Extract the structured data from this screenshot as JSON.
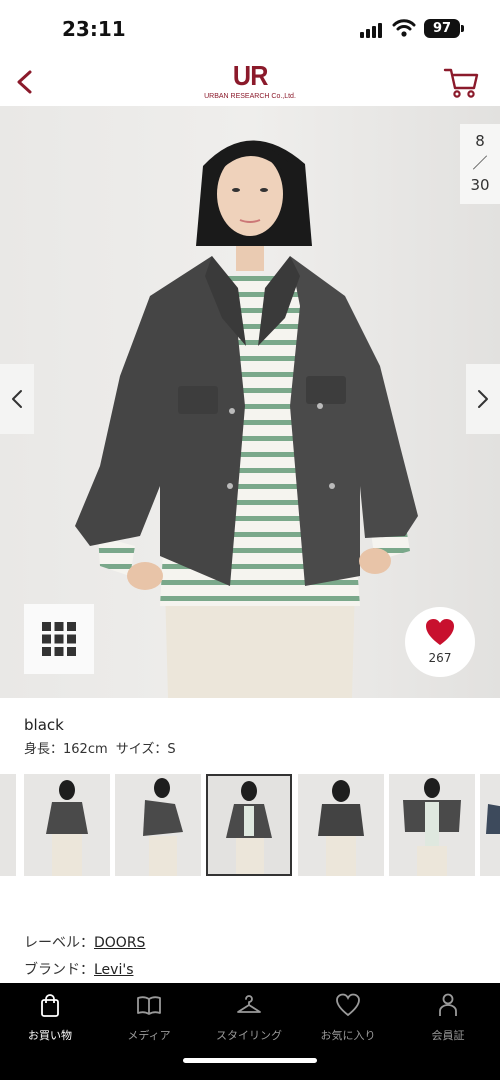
{
  "status_bar": {
    "time": "23:11",
    "battery": "97",
    "icons": [
      "signal-icon",
      "wifi-icon",
      "battery-icon"
    ]
  },
  "header": {
    "back_icon": "chevron-left-icon",
    "logo_mark": "UR",
    "logo_text": "URBAN RESEARCH Co.,Ltd.",
    "cart_icon": "cart-icon",
    "accent_color": "#8b1a2b"
  },
  "gallery": {
    "current": "8",
    "separator": "／",
    "total": "30",
    "prev_icon": "chevron-left-icon",
    "next_icon": "chevron-right-icon",
    "grid_icon": "grid-icon",
    "favorite_icon": "heart-icon",
    "favorite_count": "267",
    "favorite_color": "#c8102e"
  },
  "product": {
    "color": "black",
    "height_label": "身長：162cm",
    "size_label": "サイズ：S"
  },
  "thumbnails": [
    {
      "name": "thumb-1"
    },
    {
      "name": "thumb-2"
    },
    {
      "name": "thumb-3"
    },
    {
      "name": "thumb-4"
    },
    {
      "name": "thumb-5"
    },
    {
      "name": "thumb-6"
    },
    {
      "name": "thumb-7"
    }
  ],
  "labels": {
    "label_key": "レーベル：",
    "label_value": "DOORS",
    "brand_key": "ブランド：",
    "brand_value": "Levi's"
  },
  "bottom_nav": {
    "items": [
      {
        "label": "お買い物",
        "icon": "shopping-bag-icon",
        "active": true
      },
      {
        "label": "メディア",
        "icon": "book-icon",
        "active": false
      },
      {
        "label": "スタイリング",
        "icon": "hanger-icon",
        "active": false
      },
      {
        "label": "お気に入り",
        "icon": "heart-icon",
        "active": false
      },
      {
        "label": "会員証",
        "icon": "person-icon",
        "active": false
      }
    ]
  }
}
